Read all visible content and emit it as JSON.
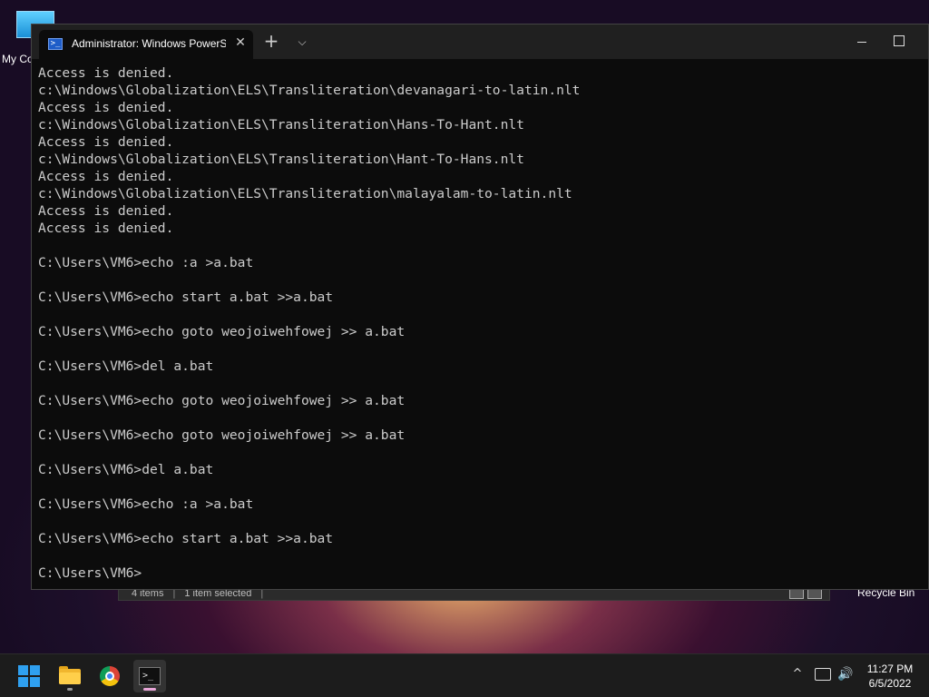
{
  "desktop": {
    "icons": [
      {
        "label": "My Co"
      }
    ],
    "recycle_bin_label": "Recycle Bin",
    "explorer_status": {
      "items": "4 items",
      "selected": "1 item selected"
    }
  },
  "terminal": {
    "tab_title": "Administrator: Windows PowerS",
    "tab_close": "✕",
    "new_tab": "+",
    "dropdown": "⌵",
    "lines": [
      "Access is denied.",
      "c:\\Windows\\Globalization\\ELS\\Transliteration\\devanagari-to-latin.nlt",
      "Access is denied.",
      "c:\\Windows\\Globalization\\ELS\\Transliteration\\Hans-To-Hant.nlt",
      "Access is denied.",
      "c:\\Windows\\Globalization\\ELS\\Transliteration\\Hant-To-Hans.nlt",
      "Access is denied.",
      "c:\\Windows\\Globalization\\ELS\\Transliteration\\malayalam-to-latin.nlt",
      "Access is denied.",
      "Access is denied.",
      "",
      "C:\\Users\\VM6>echo :a >a.bat",
      "",
      "C:\\Users\\VM6>echo start a.bat >>a.bat",
      "",
      "C:\\Users\\VM6>echo goto weojoiwehfowej >> a.bat",
      "",
      "C:\\Users\\VM6>del a.bat",
      "",
      "C:\\Users\\VM6>echo goto weojoiwehfowej >> a.bat",
      "",
      "C:\\Users\\VM6>echo goto weojoiwehfowej >> a.bat",
      "",
      "C:\\Users\\VM6>del a.bat",
      "",
      "C:\\Users\\VM6>echo :a >a.bat",
      "",
      "C:\\Users\\VM6>echo start a.bat >>a.bat",
      "",
      "C:\\Users\\VM6>"
    ]
  },
  "taskbar": {
    "pinned": [
      {
        "name": "start-button"
      },
      {
        "name": "file-explorer-button"
      },
      {
        "name": "chrome-button"
      },
      {
        "name": "terminal-button"
      }
    ],
    "tray_chevron": "^",
    "volume_icon": "🔊",
    "clock": {
      "time": "11:27 PM",
      "date": "6/5/2022"
    }
  }
}
